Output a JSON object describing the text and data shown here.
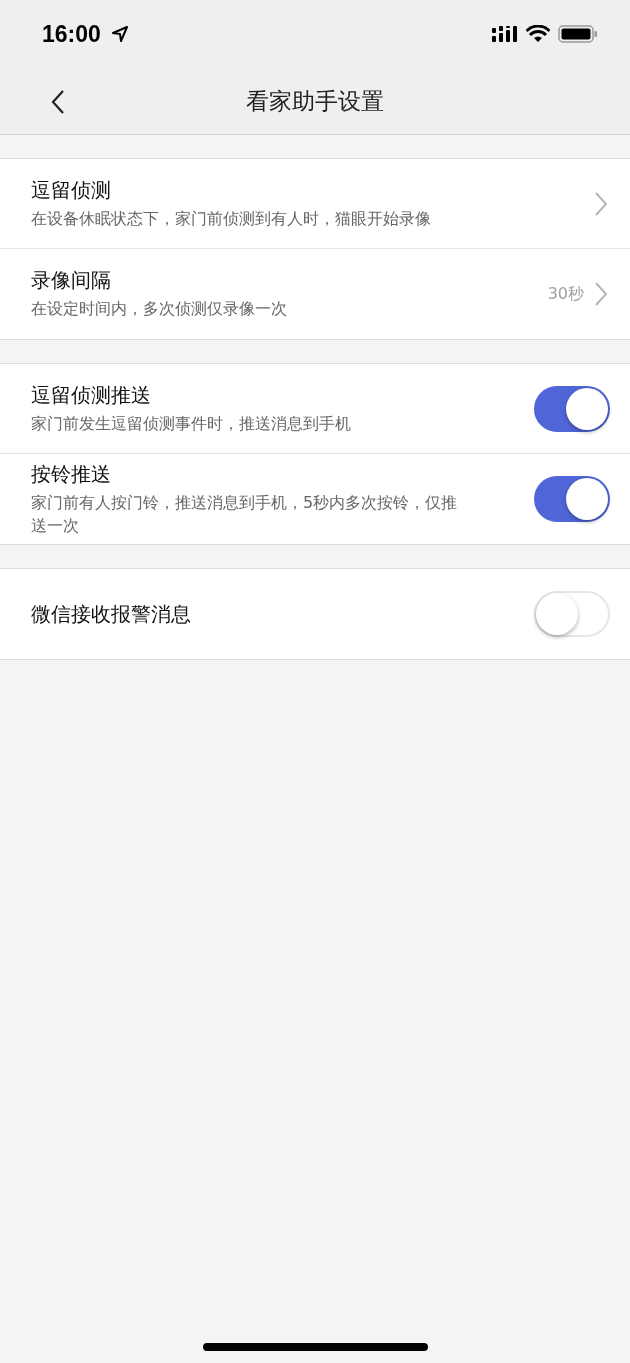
{
  "status_bar": {
    "time": "16:00"
  },
  "nav": {
    "title": "看家助手设置"
  },
  "groups": [
    {
      "items": [
        {
          "kind": "link",
          "title": "逗留侦测",
          "subtitle": "在设备休眠状态下，家门前侦测到有人时，猫眼开始录像"
        },
        {
          "kind": "link",
          "title": "录像间隔",
          "subtitle": "在设定时间内，多次侦测仅录像一次",
          "value": "30秒"
        }
      ]
    },
    {
      "items": [
        {
          "kind": "toggle",
          "title": "逗留侦测推送",
          "subtitle": "家门前发生逗留侦测事件时，推送消息到手机",
          "on": true
        },
        {
          "kind": "toggle",
          "title": "按铃推送",
          "subtitle": "家门前有人按门铃，推送消息到手机，5秒内多次按铃，仅推送一次",
          "on": true
        }
      ]
    },
    {
      "items": [
        {
          "kind": "toggle",
          "title": "微信接收报警消息",
          "on": false
        }
      ]
    }
  ]
}
